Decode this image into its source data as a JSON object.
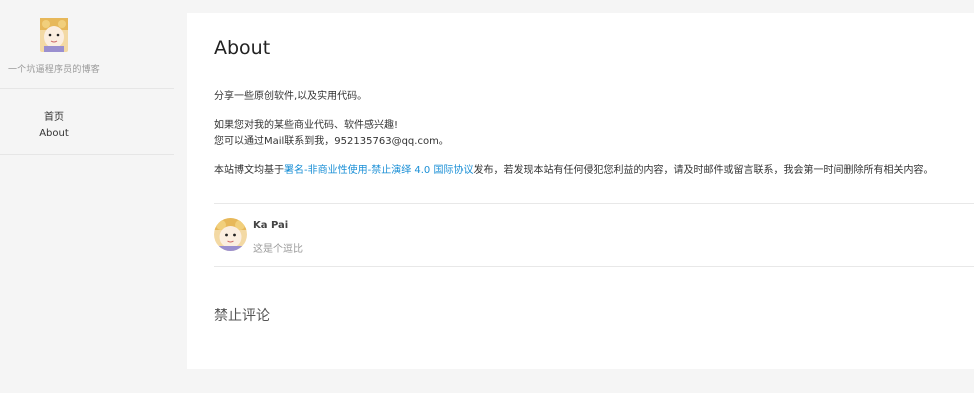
{
  "sidebar": {
    "site_description": "一个坑逼程序员的博客",
    "nav": [
      {
        "label": "首页"
      },
      {
        "label": "About"
      }
    ]
  },
  "main": {
    "title": "About",
    "intro": "分享一些原创软件,以及实用代码。",
    "contact_line1": "如果您对我的某些商业代码、软件感兴趣!",
    "contact_line2": "您可以通过Mail联系到我，952135763@qq.com。",
    "license_prefix": "本站博文均基于",
    "license_link": "署名-非商业性使用-禁止演绎 4.0 国际协议",
    "license_suffix": "发布，若发现本站有任何侵犯您利益的内容，请及时邮件或留言联系，我会第一时间删除所有相关内容。",
    "author": {
      "name": "Ka Pai",
      "bio": "这是个逗比"
    },
    "comments_status": "禁止评论"
  },
  "colors": {
    "link": "#1a8fd6",
    "background": "#f5f5f5",
    "card": "#ffffff"
  }
}
